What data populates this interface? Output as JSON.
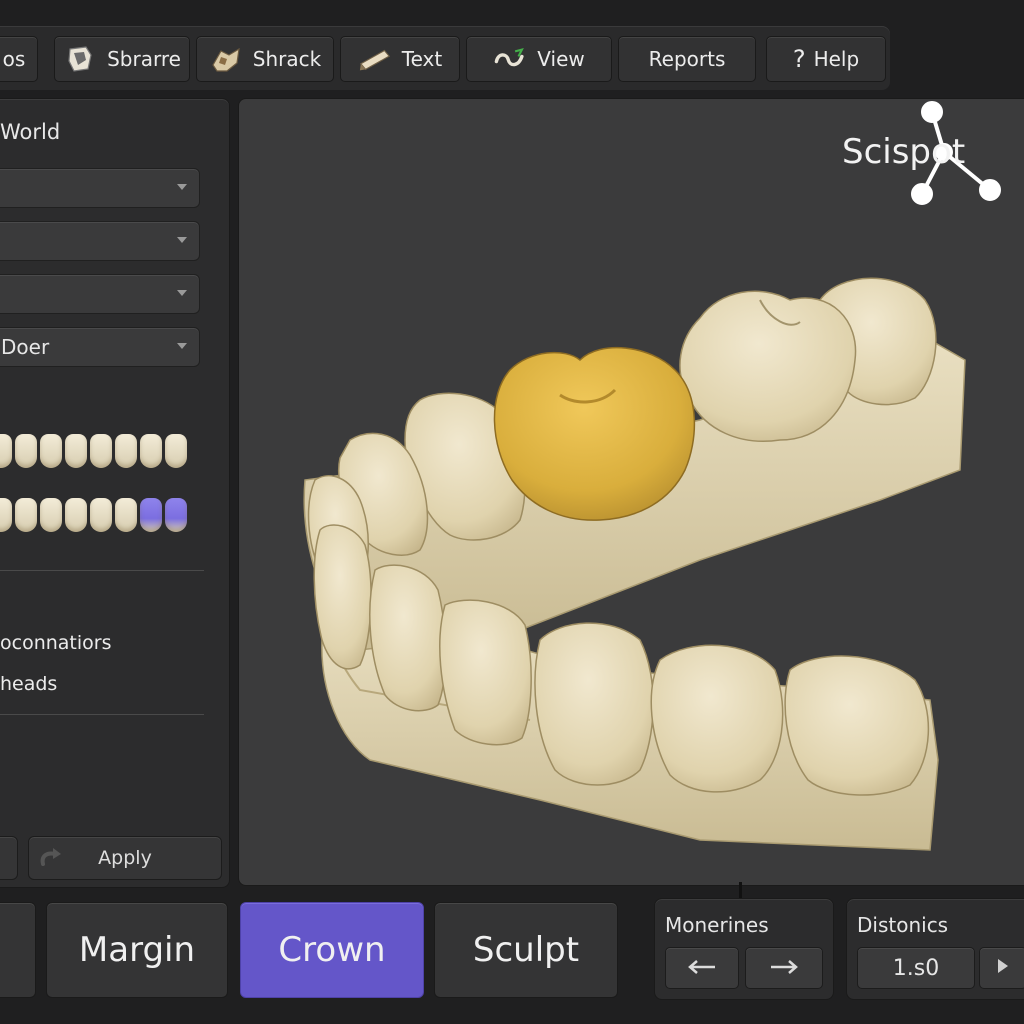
{
  "toolbar": {
    "items": [
      {
        "label": "os",
        "icon": "tools-icon"
      },
      {
        "label": "Sbrarre",
        "icon": "scan-icon"
      },
      {
        "label": "Shrack",
        "icon": "model-icon"
      },
      {
        "label": "Text",
        "icon": "text-tool-icon"
      },
      {
        "label": "View",
        "icon": "view-icon"
      },
      {
        "label": "Reports",
        "icon": ""
      },
      {
        "label": "Help",
        "icon": "help-icon",
        "glyph": "?"
      }
    ]
  },
  "left_panel": {
    "title": "World",
    "selects": [
      "",
      "",
      "",
      "Doer"
    ],
    "options": [
      "oconnatiors",
      "heads"
    ],
    "buttons": {
      "left": "",
      "apply": "Apply"
    }
  },
  "viewport": {
    "logo": "Scispot",
    "crown_color": "#d9ae3c",
    "model_color": "#e4d8b4"
  },
  "bottom_bar": {
    "modes": [
      "",
      "Margin",
      "Crown",
      "Sculpt"
    ],
    "active_mode": "Crown",
    "accent": "#6456c9",
    "monerines": {
      "label": "Monerines"
    },
    "distonics": {
      "label": "Distonics",
      "value": "1.s0"
    }
  }
}
